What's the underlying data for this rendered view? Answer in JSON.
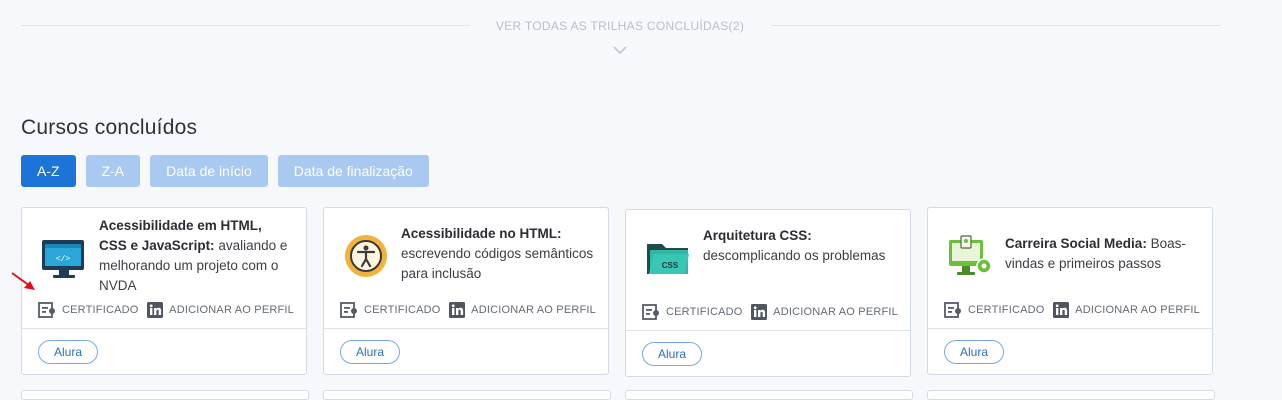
{
  "header": {
    "see_all_label": "VER TODAS AS TRILHAS CONCLUÍDAS(2)"
  },
  "section": {
    "title": "Cursos concluídos"
  },
  "sort": {
    "options": [
      "A-Z",
      "Z-A",
      "Data de início",
      "Data de finalização"
    ],
    "active": "A-Z"
  },
  "courses": [
    {
      "title_bold": "Acessibilidade em HTML, CSS e JavaScript:",
      "title_rest": " avaliando e melhorando um projeto com o NVDA",
      "icon": "html-code-monitor-icon",
      "certificate_label": "CERTIFICADO",
      "profile_label": "ADICIONAR AO PERFIL",
      "tag": "Alura"
    },
    {
      "title_bold": "Acessibilidade no HTML:",
      "title_rest": " escrevendo códigos semânticos para inclusão",
      "icon": "accessibility-person-icon",
      "certificate_label": "CERTIFICADO",
      "profile_label": "ADICIONAR AO PERFIL",
      "tag": "Alura"
    },
    {
      "title_bold": "Arquitetura CSS:",
      "title_rest": " descomplicando os problemas",
      "icon": "css-folder-icon",
      "certificate_label": "CERTIFICADO",
      "profile_label": "ADICIONAR AO PERFIL",
      "tag": "Alura"
    },
    {
      "title_bold": "Carreira Social Media:",
      "title_rest": " Boas-vindas e primeiros passos",
      "icon": "social-media-monitor-icon",
      "certificate_label": "CERTIFICADO",
      "profile_label": "ADICIONAR AO PERFIL",
      "tag": "Alura"
    }
  ],
  "colors": {
    "accent": "#1c74d9",
    "accent_light": "#a9c9f1",
    "annotation_arrow": "#e0101a"
  }
}
